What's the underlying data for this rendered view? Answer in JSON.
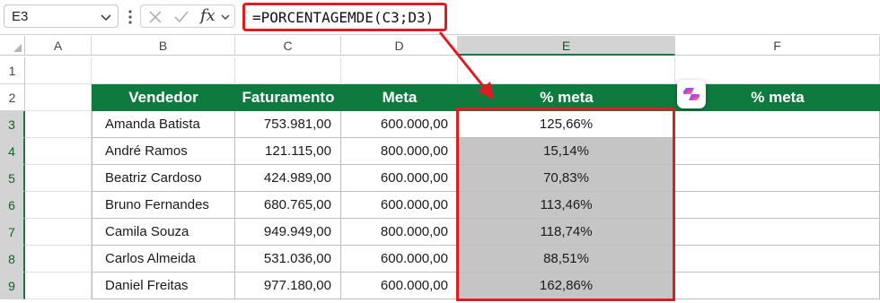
{
  "formula_bar": {
    "name_box": "E3",
    "fx_label": "fx",
    "formula": "=PORCENTAGEMDE(C3;D3)"
  },
  "column_headers": [
    "A",
    "B",
    "C",
    "D",
    "E",
    "F"
  ],
  "row_headers": [
    "1",
    "2",
    "3",
    "4",
    "5",
    "6",
    "7",
    "8",
    "9"
  ],
  "table": {
    "headers": [
      "Vendedor",
      "Faturamento",
      "Meta",
      "% meta",
      "% meta"
    ],
    "rows": [
      {
        "vendedor": "Amanda Batista",
        "faturamento": "753.981,00",
        "meta": "600.000,00",
        "pct": "125,66%"
      },
      {
        "vendedor": "André Ramos",
        "faturamento": "121.115,00",
        "meta": "800.000,00",
        "pct": "15,14%"
      },
      {
        "vendedor": "Beatriz Cardoso",
        "faturamento": "424.989,00",
        "meta": "600.000,00",
        "pct": "70,83%"
      },
      {
        "vendedor": "Bruno Fernandes",
        "faturamento": "680.765,00",
        "meta": "600.000,00",
        "pct": "113,46%"
      },
      {
        "vendedor": "Camila Souza",
        "faturamento": "949.949,00",
        "meta": "800.000,00",
        "pct": "118,74%"
      },
      {
        "vendedor": "Carlos Almeida",
        "faturamento": "531.036,00",
        "meta": "600.000,00",
        "pct": "88,51%"
      },
      {
        "vendedor": "Daniel Freitas",
        "faturamento": "977.180,00",
        "meta": "600.000,00",
        "pct": "162,86%"
      }
    ]
  },
  "colors": {
    "header_green": "#0e7a3e",
    "annotation_red": "#e01b22",
    "selection_gray": "#c5c5c5"
  }
}
